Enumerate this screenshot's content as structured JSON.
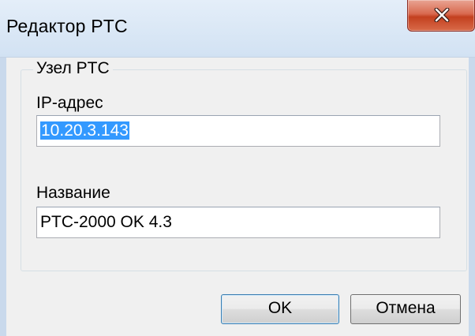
{
  "window": {
    "title": "Редактор PTC"
  },
  "group": {
    "legend": "Узел PTC"
  },
  "fields": {
    "ip_label": "IP-адрес",
    "ip_value": "10.20.3.143",
    "name_label": "Название",
    "name_value": "PTC-2000 OK 4.3"
  },
  "buttons": {
    "ok": "OK",
    "cancel": "Отмена"
  },
  "icons": {
    "close": "close-icon"
  }
}
